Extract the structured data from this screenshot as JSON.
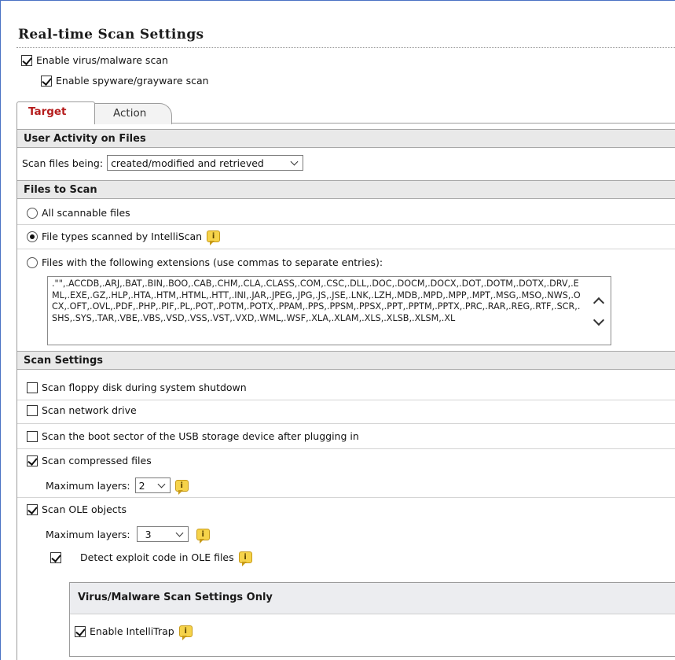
{
  "page": {
    "title": "Real-time Scan Settings"
  },
  "top_options": {
    "enable_virus": {
      "label": "Enable virus/malware scan",
      "checked": true
    },
    "enable_spyware": {
      "label": "Enable spyware/grayware scan",
      "checked": true
    }
  },
  "tabs": [
    {
      "label": "Target",
      "active": true
    },
    {
      "label": "Action",
      "active": false
    }
  ],
  "user_activity": {
    "header": "User Activity on Files",
    "scan_label": "Scan files being:",
    "scan_value": "created/modified and retrieved"
  },
  "files_to_scan": {
    "header": "Files to Scan",
    "all_files": {
      "label": "All scannable files",
      "selected": false
    },
    "intelliscan": {
      "label": "File types scanned by IntelliScan",
      "selected": true
    },
    "extensions": {
      "label": "Files with the following extensions (use commas to separate entries):",
      "selected": false
    },
    "extensions_text": ".\"\",.ACCDB,.ARJ,.BAT,.BIN,.BOO,.CAB,.CHM,.CLA,.CLASS,.COM,.CSC,.DLL,.DOC,.DOCM,.DOCX,.DOT,.DOTM,.DOTX,.DRV,.EML,.EXE,.GZ,.HLP,.HTA,.HTM,.HTML,.HTT,.INI,.JAR,.JPEG,.JPG,.JS,.JSE,.LNK,.LZH,.MDB,.MPD,.MPP,.MPT,.MSG,.MSO,.NWS,.OCX,.OFT,.OVL,.PDF,.PHP,.PIF,.PL,.POT,.POTM,.POTX,.PPAM,.PPS,.PPSM,.PPSX,.PPT,.PPTM,.PPTX,.PRC,.RAR,.REG,.RTF,.SCR,.SHS,.SYS,.TAR,.VBE,.VBS,.VSD,.VSS,.VST,.VXD,.WML,.WSF,.XLA,.XLAM,.XLS,.XLSB,.XLSM,.XL"
  },
  "scan_settings": {
    "header": "Scan Settings",
    "floppy": {
      "label": "Scan floppy disk during system shutdown",
      "checked": false
    },
    "network": {
      "label": "Scan network drive",
      "checked": false
    },
    "usb_boot": {
      "label": "Scan the boot sector of the USB storage device after plugging in",
      "checked": false
    },
    "compressed": {
      "label": "Scan compressed files",
      "checked": true
    },
    "compressed_layers_label": "Maximum layers:",
    "compressed_layers_value": "2",
    "ole": {
      "label": "Scan OLE objects",
      "checked": true
    },
    "ole_layers_label": "Maximum layers:",
    "ole_layers_value": "3",
    "exploit": {
      "label": "Detect exploit code in OLE files",
      "checked": true
    }
  },
  "virus_only": {
    "header": "Virus/Malware Scan Settings Only",
    "intellitrap": {
      "label": "Enable IntelliTrap",
      "checked": true
    }
  },
  "icons": {
    "info": "i"
  }
}
